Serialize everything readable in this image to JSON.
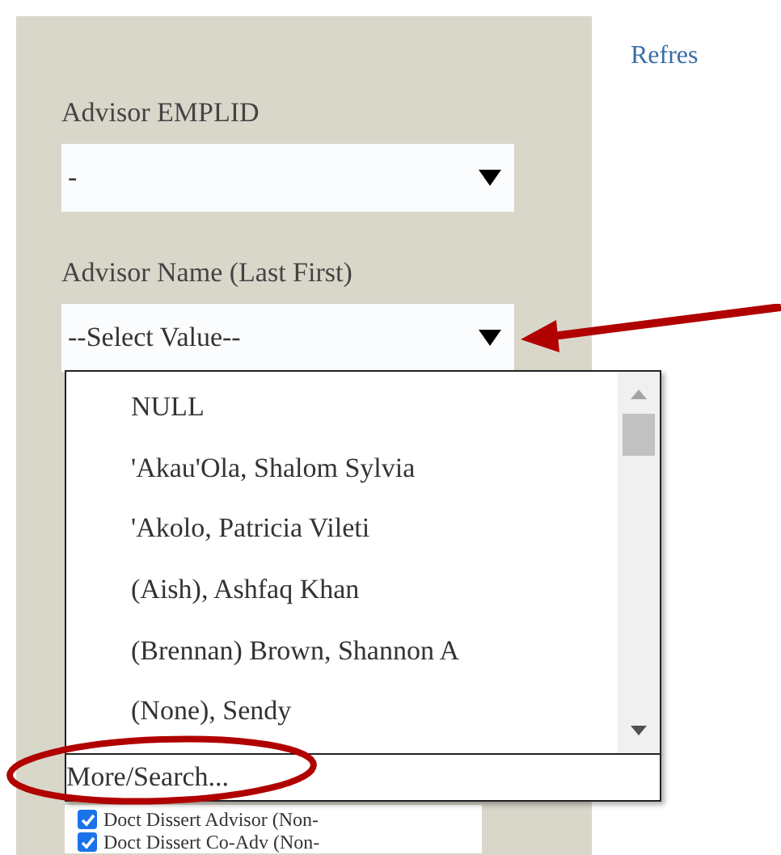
{
  "link": "Refres",
  "fields": [
    {
      "label": "Advisor EMPLID",
      "value": "-"
    },
    {
      "label": "Advisor Name (Last First)",
      "value": "--Select Value--"
    }
  ],
  "dropdown": {
    "options": [
      {
        "label": "NULL"
      },
      {
        "label": "'Akau'Ola, Shalom Sylvia"
      },
      {
        "label": "'Akolo, Patricia Vileti"
      },
      {
        "label": "(Aish), Ashfaq Khan"
      },
      {
        "label": "(Brennan) Brown, Shannon A"
      },
      {
        "label": "(None), Sendy"
      }
    ],
    "more": "More/Search..."
  },
  "checkboxes": [
    {
      "label": "Doct Dissert Advisor (Non-",
      "checked": true
    },
    {
      "label": "Doct Dissert Co-Adv (Non-",
      "checked": true
    }
  ]
}
